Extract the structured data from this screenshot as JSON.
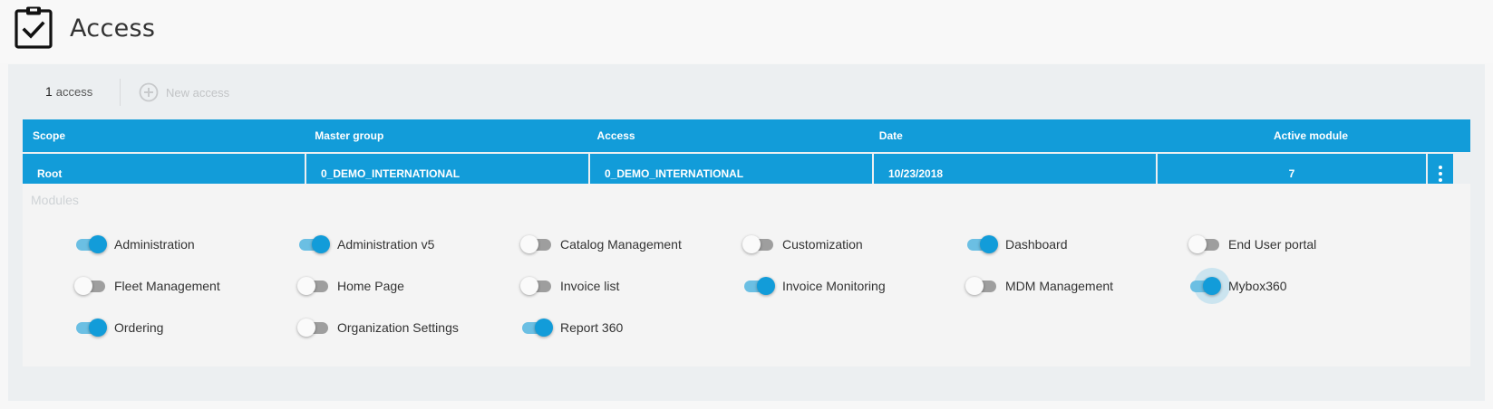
{
  "header": {
    "title": "Access",
    "icon": "clipboard-check-icon"
  },
  "toolbar": {
    "count": "1",
    "count_label": "access",
    "new_access_label": "New access",
    "new_access_icon": "plus-circle-icon"
  },
  "table": {
    "headers": {
      "scope": "Scope",
      "master_group": "Master group",
      "access": "Access",
      "date": "Date",
      "active_module": "Active module"
    },
    "row": {
      "scope": "Root",
      "master_group": "0_DEMO_INTERNATIONAL",
      "access": "0_DEMO_INTERNATIONAL",
      "date": "10/23/2018",
      "active_module": "7"
    },
    "row_menu_icon": "more-vertical-icon"
  },
  "modules": {
    "title": "Modules",
    "items": [
      {
        "label": "Administration",
        "on": true
      },
      {
        "label": "Administration v5",
        "on": true
      },
      {
        "label": "Catalog Management",
        "on": false
      },
      {
        "label": "Customization",
        "on": false
      },
      {
        "label": "Dashboard",
        "on": true
      },
      {
        "label": "End User portal",
        "on": false
      },
      {
        "label": "Fleet Management",
        "on": false
      },
      {
        "label": "Home Page",
        "on": false
      },
      {
        "label": "Invoice list",
        "on": false
      },
      {
        "label": "Invoice Monitoring",
        "on": true
      },
      {
        "label": "MDM Management",
        "on": false
      },
      {
        "label": "Mybox360",
        "on": true
      },
      {
        "label": "Ordering",
        "on": true
      },
      {
        "label": "Organization Settings",
        "on": false
      },
      {
        "label": "Report 360",
        "on": true
      }
    ]
  },
  "colors": {
    "primary": "#129cd9",
    "toggle_track_on": "#6bbfe3",
    "toggle_track_off": "#9e9e9e"
  }
}
